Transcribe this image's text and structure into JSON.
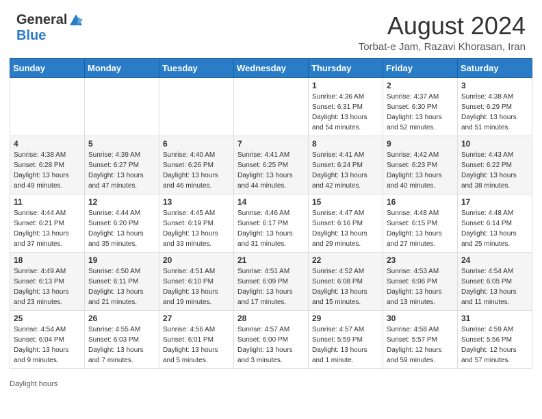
{
  "header": {
    "logo_general": "General",
    "logo_blue": "Blue",
    "month_title": "August 2024",
    "location": "Torbat-e Jam, Razavi Khorasan, Iran"
  },
  "weekdays": [
    "Sunday",
    "Monday",
    "Tuesday",
    "Wednesday",
    "Thursday",
    "Friday",
    "Saturday"
  ],
  "footer": {
    "daylight_hours": "Daylight hours"
  },
  "weeks": [
    [
      {
        "day": "",
        "sunrise": "",
        "sunset": "",
        "daylight": ""
      },
      {
        "day": "",
        "sunrise": "",
        "sunset": "",
        "daylight": ""
      },
      {
        "day": "",
        "sunrise": "",
        "sunset": "",
        "daylight": ""
      },
      {
        "day": "",
        "sunrise": "",
        "sunset": "",
        "daylight": ""
      },
      {
        "day": "1",
        "sunrise": "Sunrise: 4:36 AM",
        "sunset": "Sunset: 6:31 PM",
        "daylight": "Daylight: 13 hours and 54 minutes."
      },
      {
        "day": "2",
        "sunrise": "Sunrise: 4:37 AM",
        "sunset": "Sunset: 6:30 PM",
        "daylight": "Daylight: 13 hours and 52 minutes."
      },
      {
        "day": "3",
        "sunrise": "Sunrise: 4:38 AM",
        "sunset": "Sunset: 6:29 PM",
        "daylight": "Daylight: 13 hours and 51 minutes."
      }
    ],
    [
      {
        "day": "4",
        "sunrise": "Sunrise: 4:38 AM",
        "sunset": "Sunset: 6:28 PM",
        "daylight": "Daylight: 13 hours and 49 minutes."
      },
      {
        "day": "5",
        "sunrise": "Sunrise: 4:39 AM",
        "sunset": "Sunset: 6:27 PM",
        "daylight": "Daylight: 13 hours and 47 minutes."
      },
      {
        "day": "6",
        "sunrise": "Sunrise: 4:40 AM",
        "sunset": "Sunset: 6:26 PM",
        "daylight": "Daylight: 13 hours and 46 minutes."
      },
      {
        "day": "7",
        "sunrise": "Sunrise: 4:41 AM",
        "sunset": "Sunset: 6:25 PM",
        "daylight": "Daylight: 13 hours and 44 minutes."
      },
      {
        "day": "8",
        "sunrise": "Sunrise: 4:41 AM",
        "sunset": "Sunset: 6:24 PM",
        "daylight": "Daylight: 13 hours and 42 minutes."
      },
      {
        "day": "9",
        "sunrise": "Sunrise: 4:42 AM",
        "sunset": "Sunset: 6:23 PM",
        "daylight": "Daylight: 13 hours and 40 minutes."
      },
      {
        "day": "10",
        "sunrise": "Sunrise: 4:43 AM",
        "sunset": "Sunset: 6:22 PM",
        "daylight": "Daylight: 13 hours and 38 minutes."
      }
    ],
    [
      {
        "day": "11",
        "sunrise": "Sunrise: 4:44 AM",
        "sunset": "Sunset: 6:21 PM",
        "daylight": "Daylight: 13 hours and 37 minutes."
      },
      {
        "day": "12",
        "sunrise": "Sunrise: 4:44 AM",
        "sunset": "Sunset: 6:20 PM",
        "daylight": "Daylight: 13 hours and 35 minutes."
      },
      {
        "day": "13",
        "sunrise": "Sunrise: 4:45 AM",
        "sunset": "Sunset: 6:19 PM",
        "daylight": "Daylight: 13 hours and 33 minutes."
      },
      {
        "day": "14",
        "sunrise": "Sunrise: 4:46 AM",
        "sunset": "Sunset: 6:17 PM",
        "daylight": "Daylight: 13 hours and 31 minutes."
      },
      {
        "day": "15",
        "sunrise": "Sunrise: 4:47 AM",
        "sunset": "Sunset: 6:16 PM",
        "daylight": "Daylight: 13 hours and 29 minutes."
      },
      {
        "day": "16",
        "sunrise": "Sunrise: 4:48 AM",
        "sunset": "Sunset: 6:15 PM",
        "daylight": "Daylight: 13 hours and 27 minutes."
      },
      {
        "day": "17",
        "sunrise": "Sunrise: 4:48 AM",
        "sunset": "Sunset: 6:14 PM",
        "daylight": "Daylight: 13 hours and 25 minutes."
      }
    ],
    [
      {
        "day": "18",
        "sunrise": "Sunrise: 4:49 AM",
        "sunset": "Sunset: 6:13 PM",
        "daylight": "Daylight: 13 hours and 23 minutes."
      },
      {
        "day": "19",
        "sunrise": "Sunrise: 4:50 AM",
        "sunset": "Sunset: 6:11 PM",
        "daylight": "Daylight: 13 hours and 21 minutes."
      },
      {
        "day": "20",
        "sunrise": "Sunrise: 4:51 AM",
        "sunset": "Sunset: 6:10 PM",
        "daylight": "Daylight: 13 hours and 19 minutes."
      },
      {
        "day": "21",
        "sunrise": "Sunrise: 4:51 AM",
        "sunset": "Sunset: 6:09 PM",
        "daylight": "Daylight: 13 hours and 17 minutes."
      },
      {
        "day": "22",
        "sunrise": "Sunrise: 4:52 AM",
        "sunset": "Sunset: 6:08 PM",
        "daylight": "Daylight: 13 hours and 15 minutes."
      },
      {
        "day": "23",
        "sunrise": "Sunrise: 4:53 AM",
        "sunset": "Sunset: 6:06 PM",
        "daylight": "Daylight: 13 hours and 13 minutes."
      },
      {
        "day": "24",
        "sunrise": "Sunrise: 4:54 AM",
        "sunset": "Sunset: 6:05 PM",
        "daylight": "Daylight: 13 hours and 11 minutes."
      }
    ],
    [
      {
        "day": "25",
        "sunrise": "Sunrise: 4:54 AM",
        "sunset": "Sunset: 6:04 PM",
        "daylight": "Daylight: 13 hours and 9 minutes."
      },
      {
        "day": "26",
        "sunrise": "Sunrise: 4:55 AM",
        "sunset": "Sunset: 6:03 PM",
        "daylight": "Daylight: 13 hours and 7 minutes."
      },
      {
        "day": "27",
        "sunrise": "Sunrise: 4:56 AM",
        "sunset": "Sunset: 6:01 PM",
        "daylight": "Daylight: 13 hours and 5 minutes."
      },
      {
        "day": "28",
        "sunrise": "Sunrise: 4:57 AM",
        "sunset": "Sunset: 6:00 PM",
        "daylight": "Daylight: 13 hours and 3 minutes."
      },
      {
        "day": "29",
        "sunrise": "Sunrise: 4:57 AM",
        "sunset": "Sunset: 5:59 PM",
        "daylight": "Daylight: 13 hours and 1 minute."
      },
      {
        "day": "30",
        "sunrise": "Sunrise: 4:58 AM",
        "sunset": "Sunset: 5:57 PM",
        "daylight": "Daylight: 12 hours and 59 minutes."
      },
      {
        "day": "31",
        "sunrise": "Sunrise: 4:59 AM",
        "sunset": "Sunset: 5:56 PM",
        "daylight": "Daylight: 12 hours and 57 minutes."
      }
    ]
  ]
}
